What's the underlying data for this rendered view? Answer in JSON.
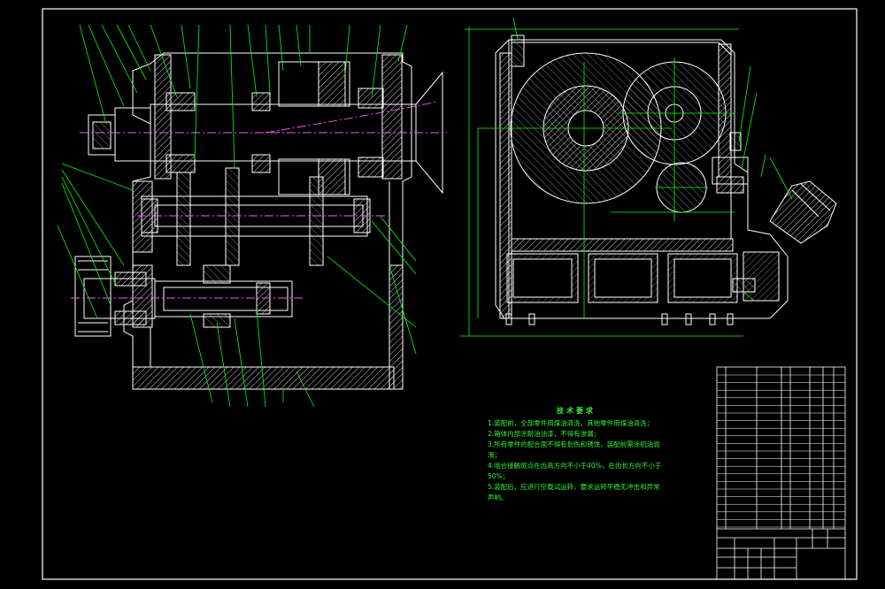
{
  "drawing": {
    "background": "#000000",
    "line_colors": {
      "outline": "#ffffff",
      "leader": "#00ff00",
      "centerline": "#ff55ff",
      "hatch": "#ffffff",
      "notes": "#2ef22e"
    }
  },
  "tech_notes": {
    "title": "技术要求",
    "items": [
      "1.装配前，全部零件用煤油清洗，其他零件用煤油清洗；",
      "2.箱体内部涂耐油油漆，不得有渗漏；",
      "3.所有零件的配合面不得有划伤和锈蚀，装配前需涂机油润滑；",
      "4.啮合接触斑点在齿高方向不小于40%，在齿长方向不小于50%；",
      "5.装配后，应进行空载试运转，要求运转平稳无冲击和异常声响。"
    ]
  }
}
